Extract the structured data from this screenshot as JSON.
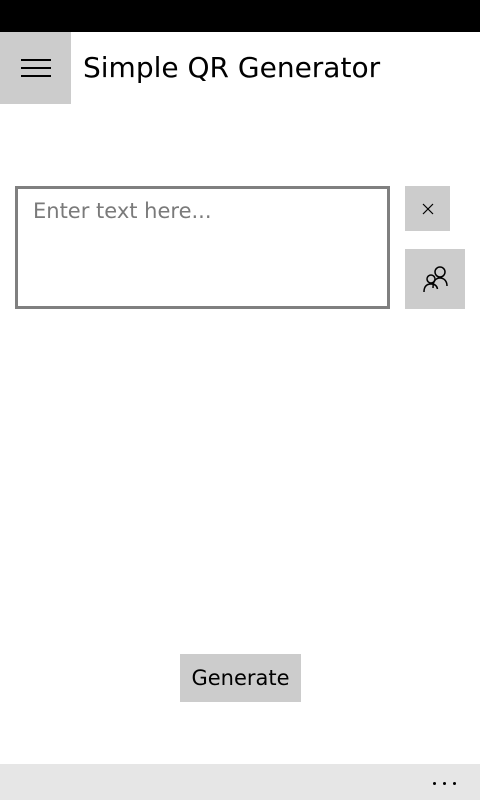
{
  "header": {
    "menu_icon": "hamburger-icon",
    "title": "Simple QR Generator"
  },
  "input": {
    "value": "",
    "placeholder": "Enter text here..."
  },
  "side_buttons": {
    "clear_icon": "close-icon",
    "contacts_icon": "contacts-icon"
  },
  "actions": {
    "generate_label": "Generate"
  },
  "app_bar": {
    "more_icon": "more-icon"
  },
  "colors": {
    "status_bar": "#000000",
    "button_bg": "#cccccc",
    "input_border": "#808080",
    "app_bar_bg": "#e6e6e6",
    "placeholder": "#7a7a7a"
  }
}
